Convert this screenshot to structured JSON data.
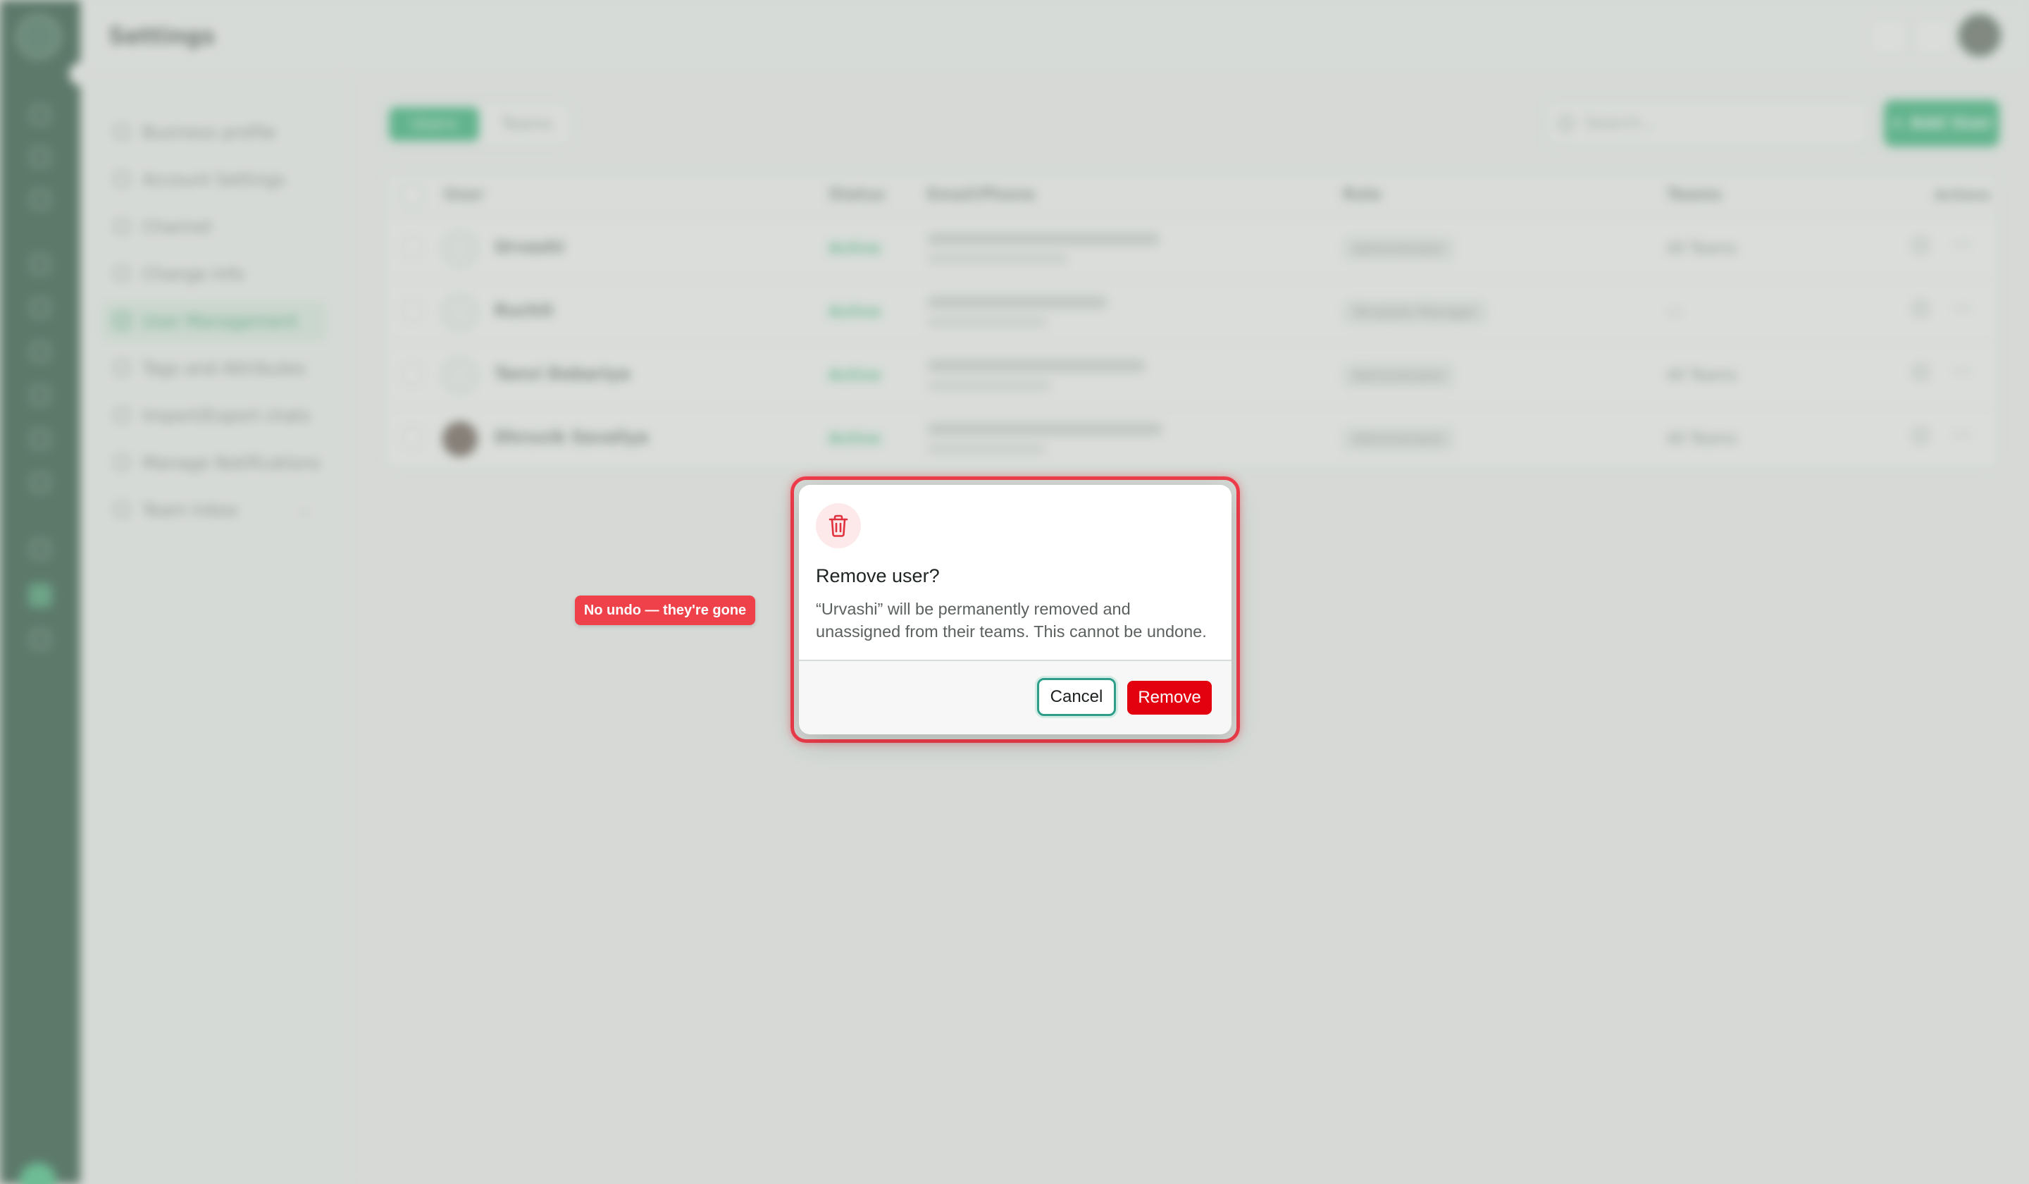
{
  "topbar": {
    "title": "Settings"
  },
  "sidebar": {
    "items": [
      {
        "label": "Business profile"
      },
      {
        "label": "Account Settings"
      },
      {
        "label": "Channel"
      },
      {
        "label": "Change Info"
      },
      {
        "label": "User Management"
      },
      {
        "label": "Tags and Attributes"
      },
      {
        "label": "Import/Export chats"
      },
      {
        "label": "Manage Notifications"
      },
      {
        "label": "Team Inbox"
      }
    ],
    "active": "User Management"
  },
  "tabs": [
    {
      "label": "Users"
    },
    {
      "label": "Teams"
    }
  ],
  "search": {
    "placeholder": "Search..."
  },
  "add_user": {
    "label": "+ Add User"
  },
  "table": {
    "columns": [
      "User",
      "Status",
      "Email/Phone",
      "Role",
      "Teams",
      "Actions"
    ],
    "rows": [
      {
        "name": "Urvashi",
        "status": "Active",
        "role": "Administrator",
        "teams": "All Teams"
      },
      {
        "name": "Ruchit",
        "status": "Active",
        "role": "Template Manager",
        "teams": "—"
      },
      {
        "name": "Tanvi Dobariya",
        "status": "Active",
        "role": "Administrator",
        "teams": "All Teams"
      },
      {
        "name": "Dhruvik Savaliya",
        "status": "Active",
        "role": "Administrator",
        "teams": "All Teams"
      }
    ]
  },
  "dialog": {
    "title": "Remove user?",
    "body": "“Urvashi” will be permanently removed and unassigned from their teams. This cannot be undone.",
    "cancel_label": "Cancel",
    "remove_label": "Remove"
  },
  "callout": {
    "text": "No undo — they're gone"
  },
  "colors": {
    "rail": "#0d3d26",
    "accent": "#18a866",
    "danger": "#e3000f",
    "highlight": "#f03d4b",
    "focus_ring": "#2e9e8a"
  }
}
